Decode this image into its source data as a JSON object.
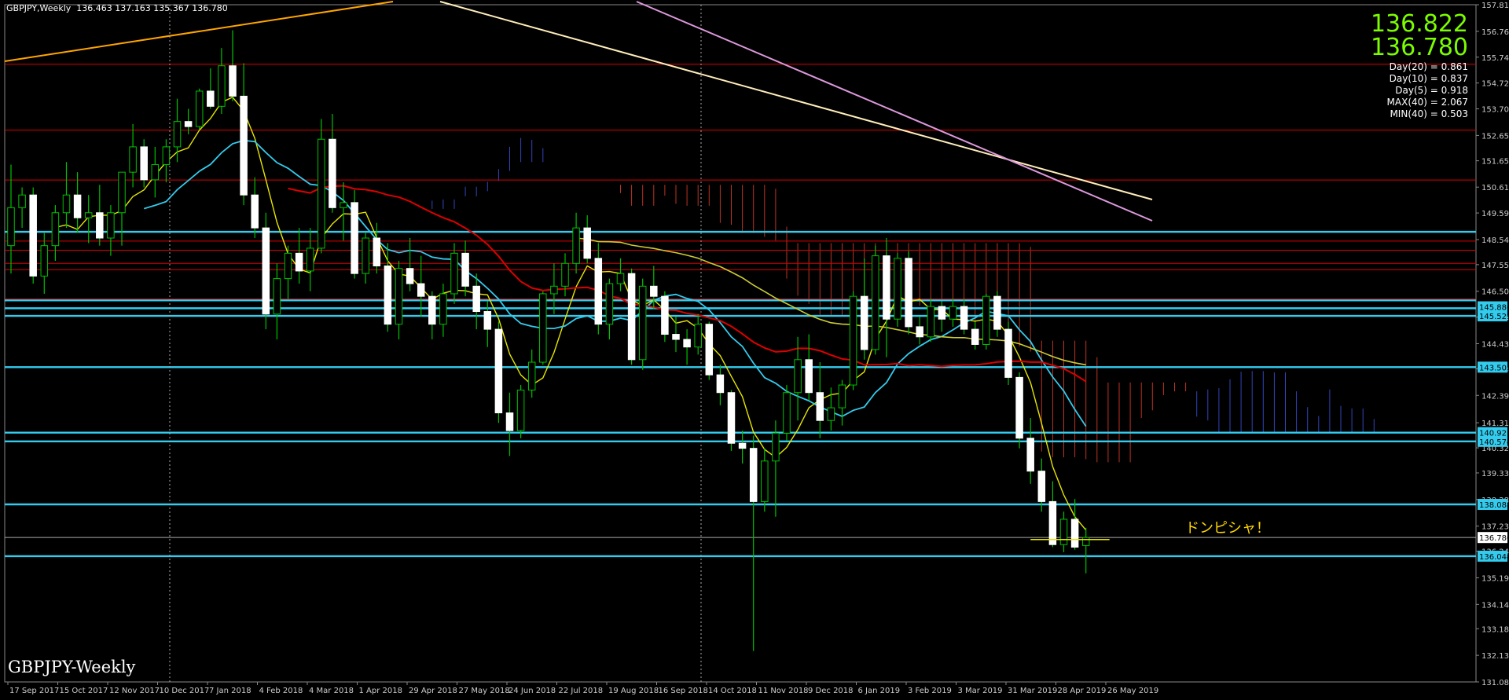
{
  "header": {
    "symbol": "GBPJPY,Weekly",
    "ohlc": "136.463 137.163 135.367 136.780"
  },
  "bottom_label": "GBPJPY-Weekly",
  "big_prices": [
    "136.822",
    "136.780"
  ],
  "stats": [
    "Day(20) = 0.861",
    "Day(10) = 0.837",
    "Day(5) = 0.918",
    "MAX(40) = 2.067",
    "MIN(40) = 0.503"
  ],
  "annotation": "ドンピシャ！",
  "colors": {
    "bull": "#00c000",
    "bear": "#ffffff",
    "cyan": "#33ccee",
    "red": "#dd0000",
    "yellow": "#e6e600",
    "magenta": "#cc66cc",
    "orange": "#ffa500",
    "axis": "#888888"
  },
  "chart_data": {
    "type": "candlestick",
    "symbol": "GBPJPY",
    "timeframe": "Weekly",
    "ylim": [
      131.08,
      157.81
    ],
    "y_ticks": [
      131.08,
      132.13,
      133.18,
      134.14,
      135.19,
      136.24,
      137.23,
      138.28,
      139.33,
      140.32,
      141.31,
      142.39,
      143.44,
      144.43,
      145.48,
      146.5,
      147.55,
      148.54,
      149.59,
      150.61,
      151.65,
      152.65,
      153.7,
      154.72,
      155.74,
      156.76,
      157.81
    ],
    "x_labels": [
      "17 Sep 2017",
      "15 Oct 2017",
      "12 Nov 2017",
      "10 Dec 2017",
      "7 Jan 2018",
      "4 Feb 2018",
      "4 Mar 2018",
      "1 Apr 2018",
      "29 Apr 2018",
      "27 May 2018",
      "24 Jun 2018",
      "22 Jul 2018",
      "19 Aug 2018",
      "16 Sep 2018",
      "14 Oct 2018",
      "11 Nov 2018",
      "9 Dec 2018",
      "6 Jan 2019",
      "3 Feb 2019",
      "3 Mar 2019",
      "31 Mar 2019",
      "28 Apr 2019",
      "26 May 2019"
    ],
    "candles": [
      [
        148.3,
        151.5,
        147.2,
        149.8
      ],
      [
        149.8,
        150.6,
        149.0,
        150.3
      ],
      [
        150.3,
        150.6,
        146.8,
        147.1
      ],
      [
        147.1,
        148.8,
        146.4,
        148.3
      ],
      [
        148.3,
        149.9,
        147.7,
        149.6
      ],
      [
        149.6,
        151.6,
        149.0,
        150.3
      ],
      [
        150.3,
        151.2,
        148.8,
        149.4
      ],
      [
        149.4,
        150.3,
        148.4,
        149.6
      ],
      [
        149.6,
        150.7,
        148.3,
        148.6
      ],
      [
        148.6,
        149.9,
        147.9,
        149.6
      ],
      [
        149.6,
        151.2,
        148.3,
        151.2
      ],
      [
        151.2,
        153.1,
        150.6,
        152.2
      ],
      [
        152.2,
        152.5,
        150.6,
        150.9
      ],
      [
        150.9,
        152.2,
        150.2,
        151.5
      ],
      [
        151.5,
        152.5,
        150.8,
        152.2
      ],
      [
        152.2,
        154.1,
        151.6,
        153.2
      ],
      [
        153.2,
        153.7,
        152.7,
        153.0
      ],
      [
        153.0,
        154.5,
        152.9,
        154.4
      ],
      [
        154.4,
        155.3,
        153.7,
        153.8
      ],
      [
        153.8,
        156.1,
        153.5,
        155.4
      ],
      [
        155.4,
        156.8,
        154.0,
        154.2
      ],
      [
        154.2,
        155.5,
        149.9,
        150.3
      ],
      [
        150.3,
        151.0,
        148.6,
        149.0
      ],
      [
        149.0,
        149.6,
        145.0,
        145.6
      ],
      [
        145.6,
        147.6,
        144.6,
        147.0
      ],
      [
        147.0,
        148.3,
        146.2,
        148.0
      ],
      [
        148.0,
        149.0,
        146.8,
        147.3
      ],
      [
        147.3,
        149.0,
        146.5,
        148.2
      ],
      [
        148.2,
        153.3,
        148.0,
        152.5
      ],
      [
        152.5,
        153.5,
        149.6,
        149.8
      ],
      [
        149.8,
        150.8,
        148.5,
        150.0
      ],
      [
        150.0,
        150.5,
        147.0,
        147.2
      ],
      [
        147.2,
        148.8,
        146.8,
        148.6
      ],
      [
        148.6,
        149.2,
        147.2,
        147.5
      ],
      [
        147.5,
        148.4,
        144.9,
        145.2
      ],
      [
        145.2,
        147.7,
        144.6,
        147.4
      ],
      [
        147.4,
        148.6,
        146.5,
        146.8
      ],
      [
        146.8,
        147.9,
        145.5,
        146.3
      ],
      [
        146.3,
        146.5,
        144.6,
        145.2
      ],
      [
        145.2,
        146.8,
        144.7,
        146.4
      ],
      [
        146.4,
        148.4,
        146.0,
        148.0
      ],
      [
        148.0,
        148.5,
        146.3,
        146.7
      ],
      [
        146.7,
        147.2,
        145.0,
        145.7
      ],
      [
        145.7,
        146.1,
        144.3,
        145.0
      ],
      [
        145.0,
        145.3,
        141.3,
        141.7
      ],
      [
        141.7,
        142.5,
        140.0,
        141.0
      ],
      [
        141.0,
        142.8,
        140.7,
        142.6
      ],
      [
        142.6,
        144.2,
        142.3,
        143.7
      ],
      [
        143.7,
        146.5,
        143.6,
        146.4
      ],
      [
        146.4,
        147.6,
        145.6,
        146.7
      ],
      [
        146.7,
        148.0,
        146.3,
        147.6
      ],
      [
        147.6,
        149.6,
        147.2,
        149.0
      ],
      [
        149.0,
        149.5,
        147.6,
        147.8
      ],
      [
        147.8,
        148.4,
        144.8,
        145.2
      ],
      [
        145.2,
        147.0,
        144.6,
        146.8
      ],
      [
        146.8,
        147.8,
        146.5,
        147.2
      ],
      [
        147.2,
        147.4,
        143.6,
        143.8
      ],
      [
        143.8,
        147.0,
        143.4,
        146.7
      ],
      [
        146.7,
        147.5,
        145.8,
        146.3
      ],
      [
        146.3,
        146.5,
        144.5,
        144.8
      ],
      [
        144.8,
        145.5,
        144.1,
        144.6
      ],
      [
        144.6,
        145.0,
        143.6,
        144.3
      ],
      [
        144.3,
        145.6,
        144.0,
        145.2
      ],
      [
        145.2,
        145.3,
        143.0,
        143.2
      ],
      [
        143.2,
        143.6,
        142.0,
        142.5
      ],
      [
        142.5,
        142.6,
        140.2,
        140.5
      ],
      [
        140.5,
        141.0,
        139.7,
        140.3
      ],
      [
        140.3,
        140.8,
        132.3,
        138.2
      ],
      [
        138.2,
        140.3,
        137.8,
        139.8
      ],
      [
        139.8,
        141.4,
        137.6,
        140.9
      ],
      [
        140.9,
        142.8,
        140.6,
        142.5
      ],
      [
        142.5,
        144.7,
        141.4,
        143.8
      ],
      [
        143.8,
        144.8,
        142.2,
        142.5
      ],
      [
        142.5,
        143.7,
        140.7,
        141.4
      ],
      [
        141.4,
        142.7,
        141.0,
        141.9
      ],
      [
        141.9,
        143.0,
        141.2,
        142.8
      ],
      [
        142.8,
        146.5,
        142.6,
        146.3
      ],
      [
        146.3,
        147.8,
        143.8,
        144.2
      ],
      [
        144.2,
        148.3,
        144.0,
        147.9
      ],
      [
        147.9,
        148.6,
        143.9,
        145.4
      ],
      [
        145.4,
        148.0,
        145.1,
        147.8
      ],
      [
        147.8,
        148.1,
        144.8,
        145.1
      ],
      [
        145.1,
        145.5,
        144.4,
        144.7
      ],
      [
        144.7,
        146.2,
        144.5,
        145.9
      ],
      [
        145.9,
        146.1,
        144.9,
        145.4
      ],
      [
        145.4,
        146.2,
        145.1,
        145.9
      ],
      [
        145.9,
        146.2,
        144.8,
        145.0
      ],
      [
        145.0,
        145.3,
        144.2,
        144.4
      ],
      [
        144.4,
        146.4,
        144.2,
        146.3
      ],
      [
        146.3,
        146.5,
        144.7,
        145.0
      ],
      [
        145.0,
        145.3,
        142.8,
        143.1
      ],
      [
        143.1,
        143.3,
        140.3,
        140.7
      ],
      [
        140.7,
        141.5,
        138.9,
        139.4
      ],
      [
        139.4,
        139.9,
        137.8,
        138.2
      ],
      [
        138.2,
        139.0,
        136.4,
        136.5
      ],
      [
        136.5,
        137.8,
        136.2,
        137.5
      ],
      [
        137.5,
        138.3,
        136.3,
        136.4
      ],
      [
        136.463,
        137.163,
        135.367,
        136.78
      ]
    ],
    "horizontal_levels": [
      {
        "price": 148.846,
        "color": "cyan"
      },
      {
        "price": 143.505,
        "color": "cyan"
      },
      {
        "price": 140.921,
        "color": "cyan"
      },
      {
        "price": 138.088,
        "color": "cyan"
      },
      {
        "price": 136.044,
        "color": "cyan"
      },
      {
        "price": 146.14,
        "color": "cyan"
      },
      {
        "price": 145.829,
        "color": "cyan"
      },
      {
        "price": 145.529,
        "color": "cyan"
      },
      {
        "price": 140.574,
        "color": "cyan"
      },
      {
        "price": 155.46,
        "color": "red"
      },
      {
        "price": 152.86,
        "color": "red"
      },
      {
        "price": 150.89,
        "color": "red"
      },
      {
        "price": 148.48,
        "color": "red"
      },
      {
        "price": 148.12,
        "color": "red"
      },
      {
        "price": 147.6,
        "color": "red"
      },
      {
        "price": 147.35,
        "color": "red"
      },
      {
        "price": 146.2,
        "color": "red"
      },
      {
        "price": 136.78,
        "color": "grey"
      }
    ],
    "price_tags": [
      {
        "price": 143.505,
        "label": "143.505",
        "color": "cyan"
      },
      {
        "price": 140.921,
        "label": "140.921",
        "color": "cyan"
      },
      {
        "price": 140.574,
        "label": "140.574",
        "color": "cyan"
      },
      {
        "price": 138.088,
        "label": "138.088",
        "color": "cyan"
      },
      {
        "price": 136.044,
        "label": "136.044",
        "color": "cyan"
      },
      {
        "price": 145.886,
        "label": "145.886",
        "color": "cyan"
      },
      {
        "price": 145.529,
        "label": "145.529",
        "color": "cyan"
      },
      {
        "price": 136.78,
        "label": "136.780",
        "color": "white"
      }
    ]
  }
}
